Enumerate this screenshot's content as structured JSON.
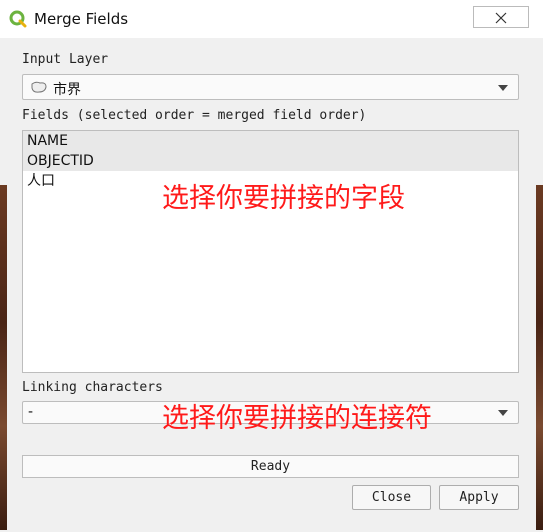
{
  "window": {
    "title": "Merge Fields"
  },
  "input_layer": {
    "label": "Input Layer",
    "value": "市界"
  },
  "fields": {
    "label": "Fields (selected order = merged field order)",
    "items": [
      {
        "name": "NAME",
        "selected": true
      },
      {
        "name": "OBJECTID",
        "selected": true
      },
      {
        "name": "人口",
        "selected": false
      }
    ]
  },
  "annotations": {
    "fields_note": "选择你要拼接的字段",
    "linking_note": "选择你要拼接的连接符"
  },
  "linking": {
    "label": "Linking characters",
    "value": "-"
  },
  "status": {
    "progress_text": "Ready"
  },
  "buttons": {
    "close": "Close",
    "apply": "Apply"
  },
  "colors": {
    "annotation": "#ff1a1a",
    "qgis_icon": "#6cb33f"
  }
}
